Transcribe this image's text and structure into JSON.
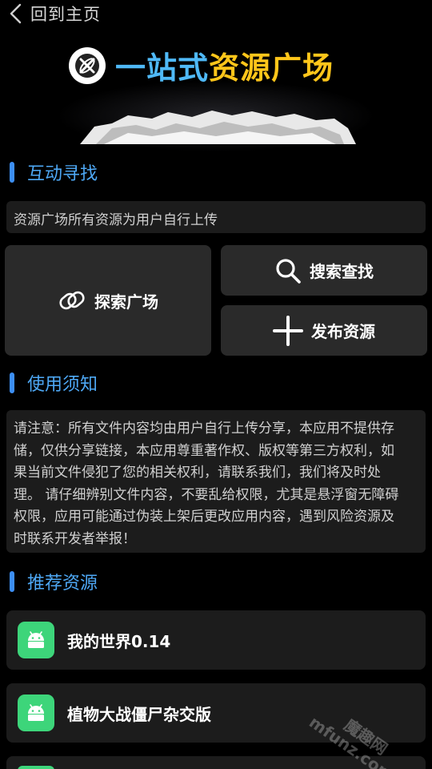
{
  "topbar": {
    "back_label": "回到主页",
    "back_icon": "chevron-left-icon"
  },
  "hero": {
    "logo_icon": "x-circle-logo-icon",
    "title_part1": "一站式",
    "title_part2": "资源广场",
    "title_color1": "#4fb9f7",
    "title_color2": "#ffc61a"
  },
  "section_interact": {
    "title": "互动寻找",
    "note": "资源广场所有资源为用户自行上传",
    "explore_label": "探索广场",
    "explore_icon": "link-icon",
    "search_label": "搜索查找",
    "search_icon": "search-icon",
    "publish_label": "发布资源",
    "publish_icon": "plus-icon"
  },
  "section_notice": {
    "title": "使用须知",
    "lines": [
      "请注意：所有文件内容均由用户自行上传分享，本应用不提供存",
      "储，仅供分享链接，本应用尊重著作权、版权等第三方权利，如",
      "果当前文件侵犯了您的相关权利，请联系我们，我们将及时处",
      "理。 请仔细辨别文件内容，不要乱给权限，尤其是悬浮窗无障碍",
      "权限，应用可能通过伪装上架后更改应用内容，遇到风险资源及",
      "时联系开发者举报！"
    ]
  },
  "section_recommend": {
    "title": "推荐资源",
    "items": [
      {
        "name": "我的世界0.14",
        "icon": "android-icon"
      },
      {
        "name": "植物大战僵尸杂交版",
        "icon": "android-icon"
      }
    ]
  },
  "watermark": {
    "line1": "魔趣网",
    "line2": "mfunz.com"
  },
  "colors": {
    "accent_blue": "#3d8ff5",
    "section_title": "#4ea8f5",
    "app_icon_green": "#3dd57a",
    "card_bg": "#2a2a2a",
    "box_bg": "#1c1c1c"
  }
}
